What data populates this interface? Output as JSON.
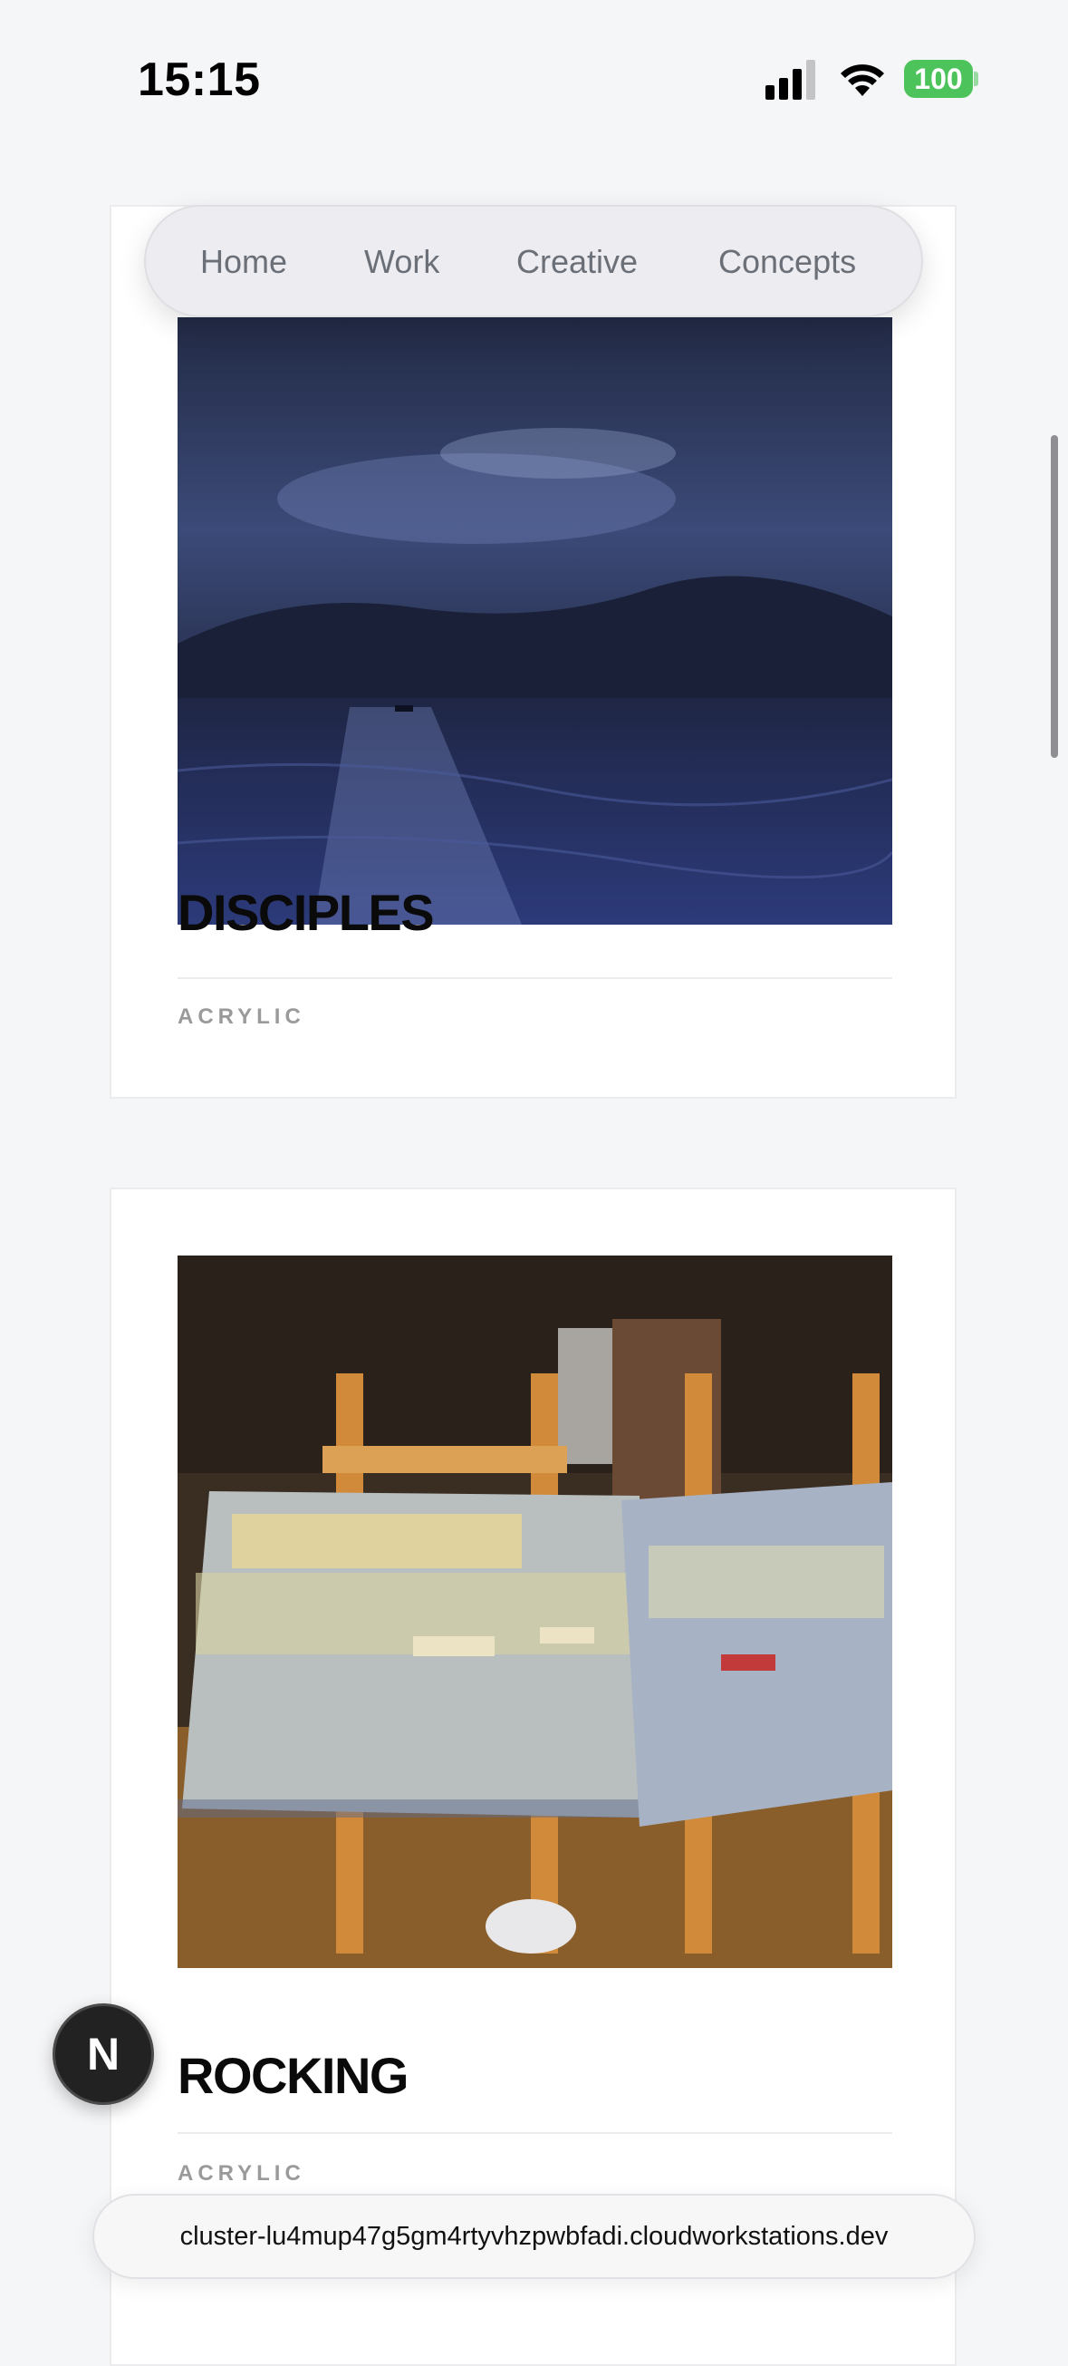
{
  "status_bar": {
    "time": "15:15",
    "battery": "100",
    "battery_color": "#4cc35b"
  },
  "nav": {
    "items": [
      {
        "label": "Home"
      },
      {
        "label": "Work"
      },
      {
        "label": "Creative"
      },
      {
        "label": "Concepts"
      }
    ]
  },
  "cards": [
    {
      "title": "DISCIPLES",
      "medium": "ACRYLIC"
    },
    {
      "title": "ROCKING",
      "medium": "ACRYLIC"
    }
  ],
  "next_badge": {
    "letter": "N"
  },
  "url_bar": {
    "url": "cluster-lu4mup47g5gm4rtyvhzpwbfadi.cloudworkstations.dev"
  }
}
